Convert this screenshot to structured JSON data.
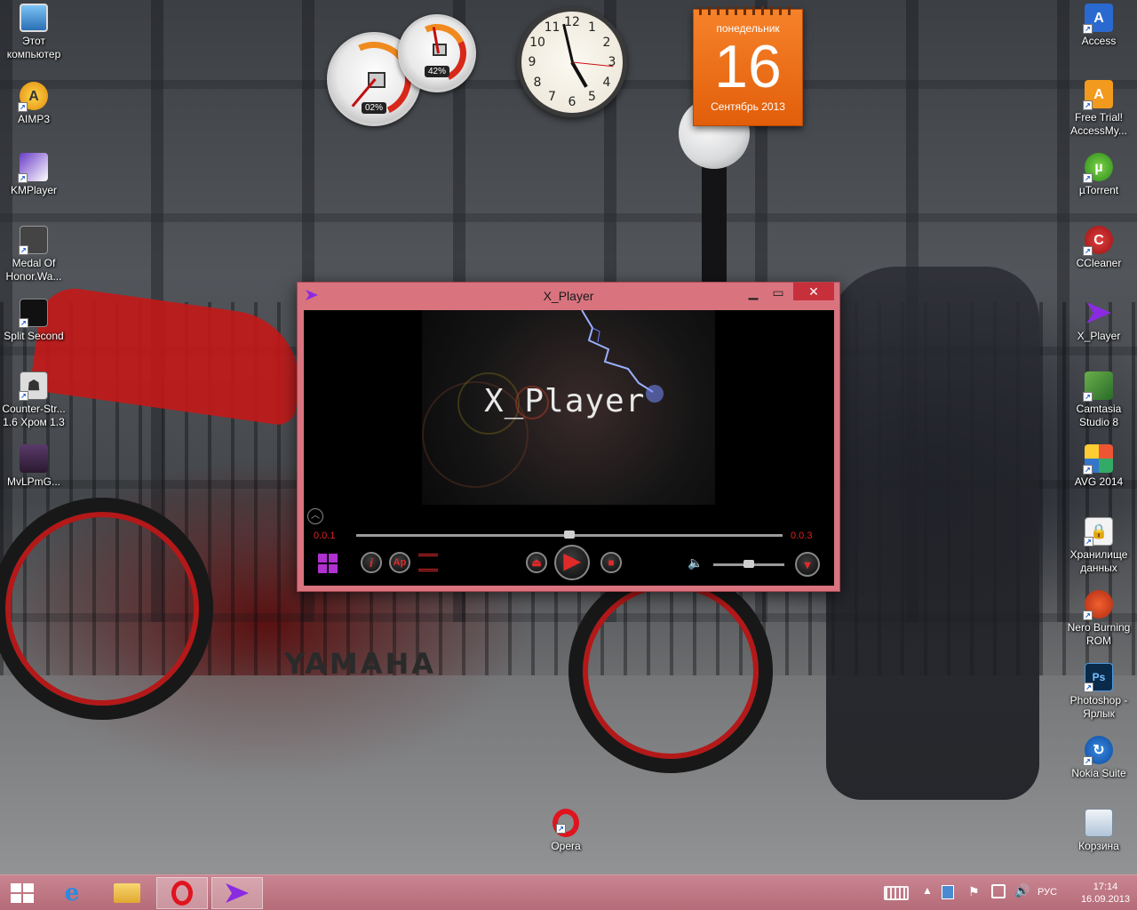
{
  "desktop_left": [
    {
      "label": "Этот компьютер",
      "icon": "computer-icon"
    },
    {
      "label": "AIMP3",
      "icon": "aimp-icon"
    },
    {
      "label": "KMPlayer",
      "icon": "kmplayer-icon"
    },
    {
      "label": "Medal Of Honor.Wa...",
      "icon": "medal-of-honor-icon"
    },
    {
      "label": "Split Second",
      "icon": "split-second-icon"
    },
    {
      "label": "Counter-Str... 1.6 Хром 1.3",
      "icon": "counter-strike-icon"
    },
    {
      "label": "MvLPmG...",
      "icon": "game-icon"
    }
  ],
  "desktop_right": [
    {
      "label": "Access",
      "icon": "access-icon"
    },
    {
      "label": "Free Trial! AccessMy...",
      "icon": "accessmy-icon"
    },
    {
      "label": "µTorrent",
      "icon": "utorrent-icon"
    },
    {
      "label": "CCleaner",
      "icon": "ccleaner-icon"
    },
    {
      "label": "X_Player",
      "icon": "xplayer-icon"
    },
    {
      "label": "Camtasia Studio 8",
      "icon": "camtasia-icon"
    },
    {
      "label": "AVG 2014",
      "icon": "avg-icon"
    },
    {
      "label": "Хранилище данных",
      "icon": "storage-icon"
    },
    {
      "label": "Nero Burning ROM",
      "icon": "nero-icon"
    },
    {
      "label": "Photoshop - Ярлык",
      "icon": "photoshop-icon"
    },
    {
      "label": "Nokia Suite",
      "icon": "nokia-suite-icon"
    },
    {
      "label": "Корзина",
      "icon": "recycle-bin-icon"
    }
  ],
  "desktop_center": {
    "label": "Opera",
    "icon": "opera-icon"
  },
  "gadgets": {
    "cpu_percent": "02%",
    "memory_percent": "42%",
    "clock_numbers": [
      "12",
      "1",
      "2",
      "3",
      "4",
      "5",
      "6",
      "7",
      "8",
      "9",
      "10",
      "11"
    ],
    "calendar": {
      "weekday": "понедельник",
      "day": "16",
      "month_year": "Сентябрь 2013"
    }
  },
  "player": {
    "window_title": "X_Player",
    "video_logo": "X_Player",
    "elapsed": "0.0.1",
    "duration": "0.0.3",
    "seek_fraction": 0.5,
    "volume_fraction": 0.5,
    "info_glyph": "i",
    "subtitles_glyph": "Ap"
  },
  "taskbar": {
    "language": "РУС",
    "time": "17:14",
    "date": "16.09.2013"
  },
  "colors": {
    "window_frame": "#d9747f",
    "taskbar": "#c98591",
    "accent_red": "#e02020",
    "calendar_orange": "#f6822a"
  }
}
